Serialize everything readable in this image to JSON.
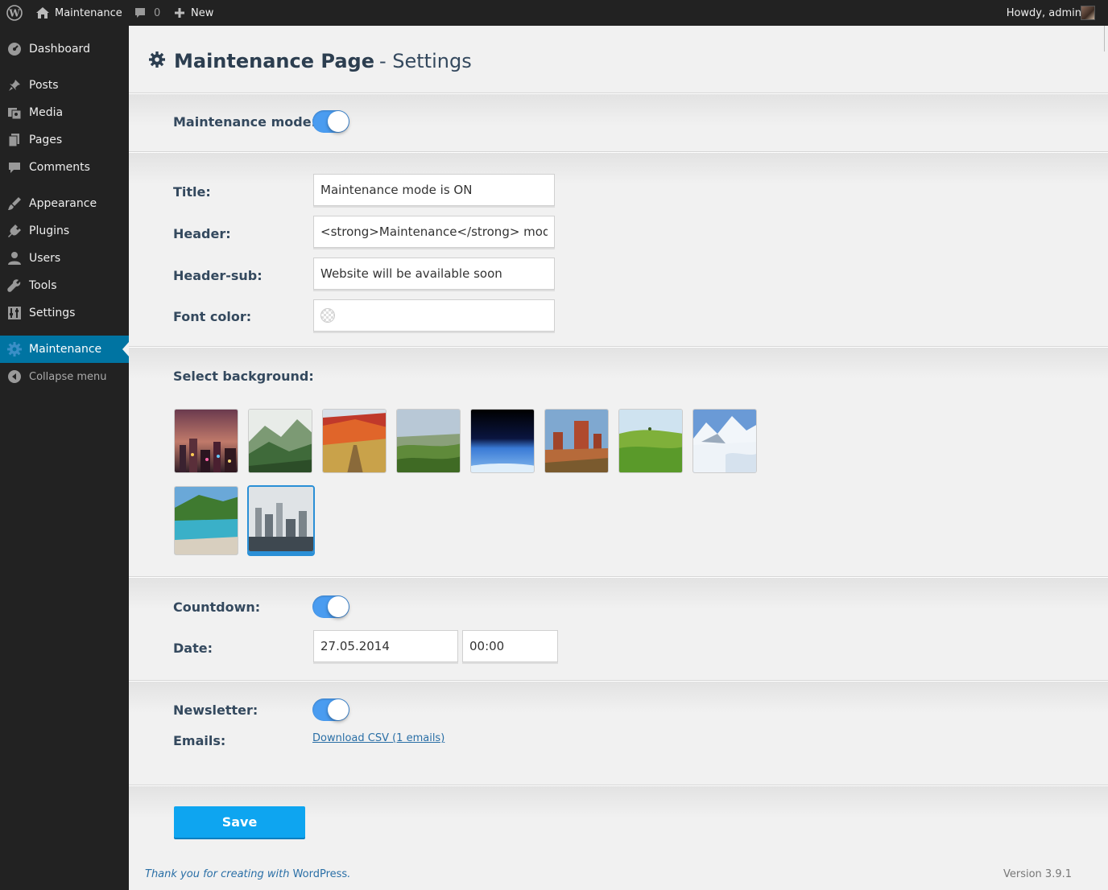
{
  "adminbar": {
    "site_name": "Maintenance",
    "comments_count": "0",
    "new_label": "New",
    "howdy": "Howdy, admin"
  },
  "sidebar": {
    "items": [
      {
        "label": "Dashboard",
        "icon": "dashboard-icon"
      },
      {
        "label": "Posts",
        "icon": "pin-icon"
      },
      {
        "label": "Media",
        "icon": "media-icon"
      },
      {
        "label": "Pages",
        "icon": "pages-icon"
      },
      {
        "label": "Comments",
        "icon": "comment-icon"
      },
      {
        "label": "Appearance",
        "icon": "brush-icon"
      },
      {
        "label": "Plugins",
        "icon": "plug-icon"
      },
      {
        "label": "Users",
        "icon": "user-icon"
      },
      {
        "label": "Tools",
        "icon": "wrench-icon"
      },
      {
        "label": "Settings",
        "icon": "settings-icon"
      },
      {
        "label": "Maintenance",
        "icon": "gear-icon",
        "active": true
      },
      {
        "label": "Collapse menu",
        "icon": "collapse-icon"
      }
    ]
  },
  "page": {
    "title_bold": "Maintenance Page",
    "title_sub": "- Settings"
  },
  "form": {
    "maintenance_mode_label": "Maintenance mode:",
    "maintenance_mode_on": true,
    "title_label": "Title:",
    "title_value": "Maintenance mode is ON",
    "header_label": "Header:",
    "header_value": "<strong>Maintenance</strong> mode",
    "header_sub_label": "Header-sub:",
    "header_sub_value": "Website will be available soon",
    "font_color_label": "Font color:",
    "select_bg_label": "Select background:",
    "backgrounds": [
      "city-night",
      "green-mountains",
      "autumn-hill",
      "green-valley",
      "space-earth",
      "desert-rocks",
      "green-field",
      "snow-mountains",
      "tropical-bay",
      "foggy-city"
    ],
    "selected_background": "foggy-city",
    "countdown_label": "Countdown:",
    "countdown_on": true,
    "date_label": "Date:",
    "date_value": "27.05.2014",
    "time_value": "00:00",
    "newsletter_label": "Newsletter:",
    "newsletter_on": true,
    "emails_label": "Emails:",
    "download_link": "Download CSV (1 emails)",
    "save_label": "Save"
  },
  "footer": {
    "thanks": "Thank you for creating with ",
    "wp": "WordPress",
    "dot": ".",
    "version": "Version 3.9.1"
  },
  "colors": {
    "sidebar_bg": "#222222",
    "active_menu": "#0074a2",
    "toggle_on": "#4a9cf0",
    "save_button": "#0ea5f0",
    "title": "#2c3e50"
  }
}
